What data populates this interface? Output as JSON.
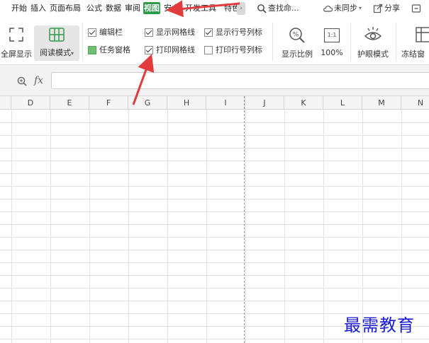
{
  "tabs": [
    {
      "label": "开始"
    },
    {
      "label": "插入"
    },
    {
      "label": "页面布局"
    },
    {
      "label": "公式"
    },
    {
      "label": "数据"
    },
    {
      "label": "审阅"
    },
    {
      "label": "视图"
    },
    {
      "label": "安全"
    },
    {
      "label": "开发工具"
    },
    {
      "label": "特色"
    }
  ],
  "active_tab": "视图",
  "active_color": "#2e9a49",
  "right_tools": {
    "search": "查找命...",
    "sync": "未同步",
    "share": "分享"
  },
  "ribbon": {
    "fullscreen_label": "全屏显示",
    "read_mode_label": "阅读模式",
    "checkboxes": [
      {
        "label": "编辑栏",
        "checked": true
      },
      {
        "label": "任务窗格",
        "checked": false
      },
      {
        "label": "显示网格线",
        "checked": true
      },
      {
        "label": "打印网格线",
        "checked": true
      },
      {
        "label": "显示行号列标",
        "checked": true
      },
      {
        "label": "打印行号列标",
        "checked": false
      }
    ],
    "zoom_label": "显示比例",
    "zoom100_label": "100%",
    "zoom100_icon_text": "1:1",
    "eye_label": "护眼模式",
    "freeze_label": "冻结窗"
  },
  "formula": {
    "fx": "fx"
  },
  "columns": [
    "D",
    "E",
    "F",
    "G",
    "H",
    "I",
    "J",
    "K",
    "L",
    "M",
    "N"
  ],
  "watermark": "最需教育",
  "annotation_color": "#e23b3b"
}
